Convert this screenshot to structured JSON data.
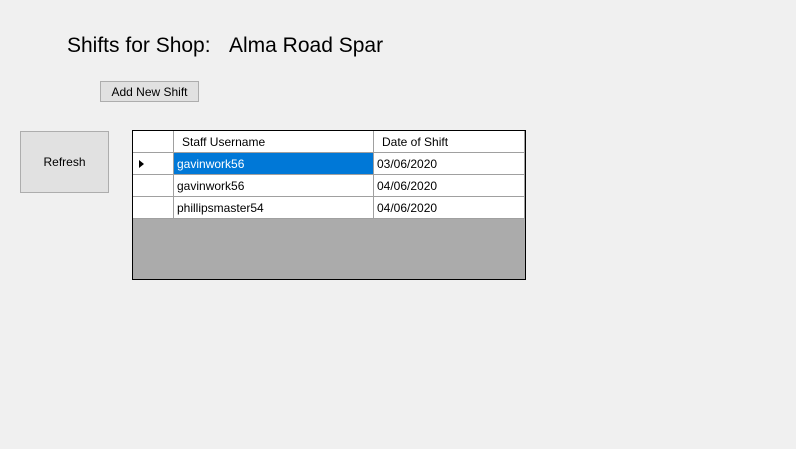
{
  "header": {
    "title_label": "Shifts for Shop:",
    "shop_name": "Alma Road Spar"
  },
  "buttons": {
    "add_new_shift": "Add New Shift",
    "refresh": "Refresh"
  },
  "grid": {
    "columns": [
      "Staff Username",
      "Date of Shift"
    ],
    "rows": [
      {
        "username": "gavinwork56",
        "date": "03/06/2020",
        "selected": true
      },
      {
        "username": "gavinwork56",
        "date": "04/06/2020",
        "selected": false
      },
      {
        "username": "phillipsmaster54",
        "date": "04/06/2020",
        "selected": false
      }
    ],
    "current_row_indicator": "triangle-right-icon",
    "selection_color": "#0078d7"
  }
}
